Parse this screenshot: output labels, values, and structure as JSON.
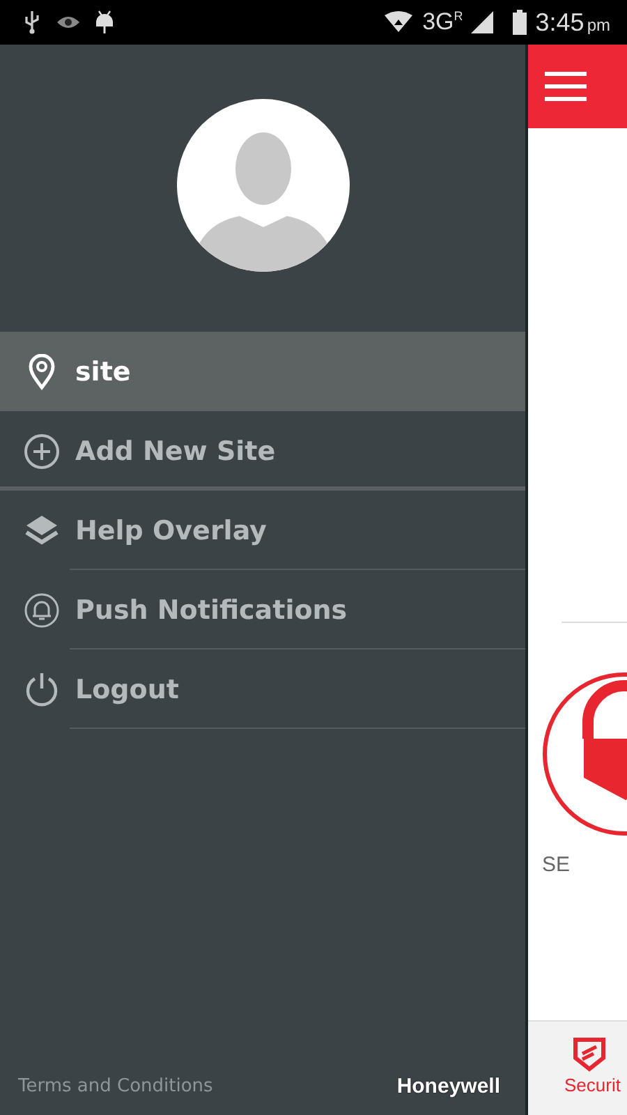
{
  "status_bar": {
    "network": "3G",
    "roaming": "R",
    "time": "3:45",
    "ampm": "pm"
  },
  "drawer": {
    "menu": [
      {
        "kind": "location",
        "label": "site",
        "selected": true
      },
      {
        "kind": "add",
        "label": "Add New Site",
        "selected": false
      },
      {
        "kind": "layers",
        "label": "Help Overlay",
        "selected": false
      },
      {
        "kind": "bell",
        "label": "Push Notifications",
        "selected": false
      },
      {
        "kind": "power",
        "label": "Logout",
        "selected": false
      }
    ],
    "footer": {
      "link": "Terms and Conditions",
      "brand": "Honeywell"
    }
  },
  "background_app": {
    "card_label": "SE",
    "bottom_nav": [
      {
        "label": "Securit",
        "selected": true
      }
    ]
  }
}
